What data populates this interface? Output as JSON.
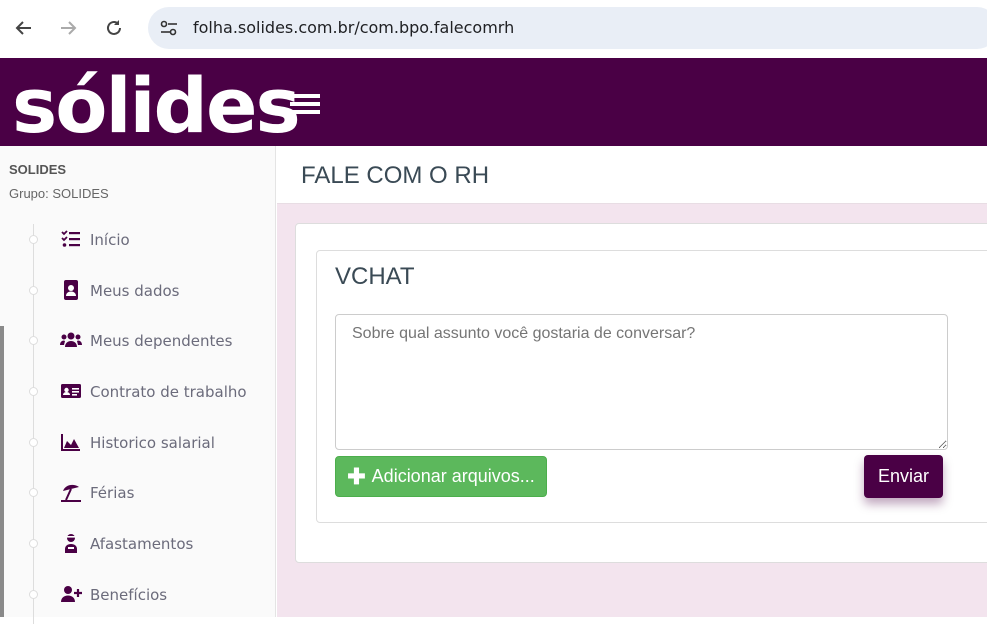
{
  "browser": {
    "url": "folha.solides.com.br/com.bpo.falecomrh"
  },
  "header": {
    "logo_text": "sólides",
    "brand_color": "#4a0045"
  },
  "sidebar": {
    "company": "SOLIDES",
    "group": "Grupo: SOLIDES",
    "items": [
      {
        "label": "Início",
        "icon": "checklist-icon"
      },
      {
        "label": "Meus dados",
        "icon": "contact-book-icon"
      },
      {
        "label": "Meus dependentes",
        "icon": "users-icon"
      },
      {
        "label": "Contrato de trabalho",
        "icon": "id-card-icon"
      },
      {
        "label": "Historico salarial",
        "icon": "area-chart-icon"
      },
      {
        "label": "Férias",
        "icon": "beach-umbrella-icon"
      },
      {
        "label": "Afastamentos",
        "icon": "user-injured-icon"
      },
      {
        "label": "Benefícios",
        "icon": "user-plus-icon"
      }
    ]
  },
  "main": {
    "page_title": "FALE COM O RH",
    "chat_title": "VCHAT",
    "message_placeholder": "Sobre qual assunto você gostaria de conversar?",
    "add_files_label": "Adicionar arquivos...",
    "send_label": "Enviar",
    "colors": {
      "add_button": "#5cb85c",
      "send_button": "#4a0045",
      "background": "#f3e4ee"
    }
  }
}
